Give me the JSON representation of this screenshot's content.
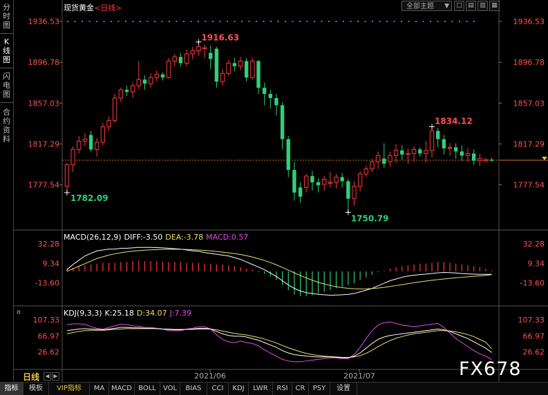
{
  "sidebar": {
    "tabs": [
      {
        "label": "分时图",
        "lines": [
          "分",
          "时",
          "图"
        ]
      },
      {
        "label": "K线图",
        "lines": [
          "K",
          "线",
          "图"
        ],
        "active": true
      },
      {
        "label": "闪电图",
        "lines": [
          "闪",
          "电",
          "图"
        ]
      },
      {
        "label": "合约资料",
        "lines": [
          "合",
          "约",
          "资",
          "料"
        ]
      }
    ]
  },
  "header": {
    "title": "现货黄金",
    "period": "<日线>",
    "theme_select": "全部主题",
    "theme_arrow": "▼",
    "tool_buttons": [
      "□",
      "▤",
      "▥"
    ]
  },
  "price_panel": {
    "right_axis_labels": [
      "1936.53",
      "1896.78",
      "1857.03",
      "1817.29",
      "1777.54"
    ],
    "left_axis_labels": [
      "1936.53",
      "1896.78",
      "1857.03",
      "1817.29",
      "1777.54"
    ],
    "annotations": {
      "high": "1916.63",
      "low": "1750.79",
      "left_low": "1782.09",
      "recent_high": "1834.12"
    },
    "current_price": 1801.5,
    "ylim": [
      1745,
      1944
    ]
  },
  "macd_panel": {
    "label": "MACD(26,12,9)",
    "diff": "DIFF:-3.50",
    "dea": "DEA:-3.78",
    "macd": "MACD:0.57",
    "axis_labels": [
      "32.28",
      "9.34",
      "-13.60"
    ]
  },
  "kdj_panel": {
    "label": "KDJ(9,3,3)",
    "k": "K:25.18",
    "d": "D:34.07",
    "j": "J:7.39",
    "axis_labels": [
      "107.33",
      "66.97",
      "26.62"
    ]
  },
  "x_axis": {
    "labels": [
      "2021/06",
      "2021/07"
    ]
  },
  "footer": {
    "period_label": "日线",
    "tabs": [
      "指标",
      "模板",
      "VIP指标",
      "MA",
      "MACD",
      "BOLL",
      "VOL",
      "BIAS",
      "CCI",
      "KDJ",
      "LWR",
      "RSI",
      "CR",
      "PSY",
      "设置"
    ]
  },
  "watermark": "FX678",
  "colors": {
    "up": "#ff3b3b",
    "down": "#2fd07a",
    "diff": "#ffffff",
    "dea": "#e9e26a",
    "j": "#e64ce6",
    "axis_red": "#ff5050"
  },
  "chart_data": {
    "type": "candlestick",
    "candles": [
      [
        1776,
        1797,
        1770,
        1799
      ],
      [
        1797,
        1812,
        1790,
        1815
      ],
      [
        1812,
        1820,
        1808,
        1825
      ],
      [
        1820,
        1822,
        1815,
        1828
      ],
      [
        1826,
        1812,
        1810,
        1830
      ],
      [
        1812,
        1819,
        1805,
        1823
      ],
      [
        1819,
        1834,
        1816,
        1838
      ],
      [
        1834,
        1840,
        1830,
        1844
      ],
      [
        1840,
        1862,
        1838,
        1866
      ],
      [
        1862,
        1870,
        1858,
        1872
      ],
      [
        1870,
        1868,
        1864,
        1874
      ],
      [
        1868,
        1874,
        1862,
        1877
      ],
      [
        1874,
        1880,
        1870,
        1898
      ],
      [
        1880,
        1876,
        1870,
        1884
      ],
      [
        1876,
        1882,
        1872,
        1886
      ],
      [
        1882,
        1885,
        1878,
        1889
      ],
      [
        1885,
        1882,
        1879,
        1887
      ],
      [
        1882,
        1898,
        1881,
        1901
      ],
      [
        1898,
        1902,
        1893,
        1905
      ],
      [
        1902,
        1896,
        1893,
        1906
      ],
      [
        1896,
        1905,
        1893,
        1909
      ],
      [
        1905,
        1908,
        1900,
        1912
      ],
      [
        1908,
        1912,
        1903,
        1916.63
      ],
      [
        1910,
        1911,
        1901,
        1914
      ],
      [
        1906,
        1900,
        1890,
        1913
      ],
      [
        1910,
        1878,
        1872,
        1912
      ],
      [
        1878,
        1886,
        1874,
        1890
      ],
      [
        1886,
        1896,
        1884,
        1899
      ],
      [
        1896,
        1893,
        1888,
        1901
      ],
      [
        1893,
        1898,
        1889,
        1902
      ],
      [
        1898,
        1882,
        1878,
        1901
      ],
      [
        1882,
        1898,
        1880,
        1901
      ],
      [
        1898,
        1872,
        1866,
        1899
      ],
      [
        1872,
        1866,
        1855,
        1877
      ],
      [
        1866,
        1862,
        1852,
        1870
      ],
      [
        1862,
        1855,
        1845,
        1866
      ],
      [
        1855,
        1822,
        1812,
        1858
      ],
      [
        1822,
        1792,
        1785,
        1825
      ],
      [
        1792,
        1770,
        1762,
        1800
      ],
      [
        1775,
        1766,
        1760,
        1780
      ],
      [
        1775,
        1786,
        1770,
        1788
      ],
      [
        1786,
        1780,
        1772,
        1791
      ],
      [
        1780,
        1777,
        1770,
        1784
      ],
      [
        1778,
        1783,
        1772,
        1786
      ],
      [
        1779,
        1780,
        1775,
        1790
      ],
      [
        1780,
        1785,
        1774,
        1788
      ],
      [
        1785,
        1781,
        1775,
        1789
      ],
      [
        1781,
        1764,
        1750.79,
        1783
      ],
      [
        1764,
        1776,
        1757,
        1781
      ],
      [
        1776,
        1788,
        1771,
        1791
      ],
      [
        1788,
        1793,
        1785,
        1796
      ],
      [
        1793,
        1800,
        1790,
        1803
      ],
      [
        1800,
        1806,
        1793,
        1810
      ],
      [
        1803,
        1798,
        1794,
        1818
      ],
      [
        1800,
        1806,
        1795,
        1810
      ],
      [
        1806,
        1811,
        1799,
        1817
      ],
      [
        1811,
        1807,
        1802,
        1816
      ],
      [
        1807,
        1808,
        1798,
        1813
      ],
      [
        1808,
        1812,
        1800,
        1815
      ],
      [
        1812,
        1808,
        1805,
        1814
      ],
      [
        1808,
        1811,
        1799,
        1820
      ],
      [
        1811,
        1830,
        1804,
        1834.12
      ],
      [
        1830,
        1822,
        1814,
        1833
      ],
      [
        1822,
        1813,
        1807,
        1826
      ],
      [
        1813,
        1814,
        1806,
        1818
      ],
      [
        1814,
        1810,
        1803,
        1818
      ],
      [
        1810,
        1806,
        1801,
        1816
      ],
      [
        1806,
        1808,
        1800,
        1813
      ],
      [
        1808,
        1801,
        1797,
        1812
      ],
      [
        1801,
        1803,
        1796,
        1808
      ],
      [
        1801,
        1802,
        1799,
        1804
      ],
      [
        1802,
        1801,
        1800,
        1804
      ]
    ],
    "macd_hist": [
      3,
      4,
      6,
      7,
      8,
      9,
      10,
      10,
      10,
      11,
      11,
      12,
      13,
      12,
      12,
      12,
      11,
      11,
      11,
      11,
      10,
      10,
      10,
      9,
      9,
      8,
      8,
      7,
      6,
      5,
      3,
      2,
      -1,
      -3,
      -6,
      -10,
      -16,
      -22,
      -27,
      -29,
      -29,
      -28,
      -26,
      -24,
      -22,
      -20,
      -18,
      -16,
      -14,
      -10,
      -7,
      -4,
      -1,
      1,
      3,
      5,
      6,
      7,
      8,
      9,
      9,
      10,
      11,
      11,
      10,
      9,
      8,
      7,
      6,
      5,
      3,
      1
    ],
    "diff": [
      2,
      8,
      13,
      18,
      21,
      24,
      25,
      26,
      26,
      27,
      27,
      27.5,
      28,
      28,
      28,
      27.8,
      27.5,
      27,
      26.5,
      26,
      25,
      24,
      23.5,
      22,
      21,
      20,
      19,
      18,
      16,
      14,
      11,
      8,
      5,
      2,
      -2,
      -6,
      -11,
      -16,
      -20,
      -23,
      -25,
      -26,
      -27,
      -27.5,
      -28,
      -27.8,
      -27.5,
      -27,
      -26,
      -24,
      -22,
      -20,
      -17,
      -14,
      -11,
      -9,
      -7,
      -5.5,
      -4.5,
      -3.8,
      -3.2,
      -2.5,
      -1.8,
      -1.3,
      -1.5,
      -2,
      -2.6,
      -3,
      -3.3,
      -3.5,
      -3.5,
      -3.5
    ],
    "dea": [
      0,
      3,
      6,
      9,
      12,
      15,
      17,
      19,
      20.5,
      21.8,
      22.8,
      23.6,
      24.3,
      24.8,
      25.2,
      25.5,
      25.7,
      25.8,
      25.8,
      25.8,
      25.6,
      25.3,
      25,
      24.5,
      24,
      23.3,
      22.5,
      21.7,
      20.8,
      19.7,
      18.3,
      16.7,
      14.8,
      12.7,
      10.3,
      7.6,
      4.6,
      1.4,
      -1.8,
      -4.9,
      -7.8,
      -10.4,
      -12.8,
      -14.8,
      -16.6,
      -18,
      -19.1,
      -19.9,
      -20.4,
      -20.6,
      -20.5,
      -20.2,
      -19.6,
      -18.8,
      -17.8,
      -16.7,
      -15.6,
      -14.4,
      -13.3,
      -12.3,
      -11.4,
      -10.5,
      -9.7,
      -9,
      -8.3,
      -7.6,
      -7,
      -6.4,
      -5.8,
      -5.3,
      -4.8,
      -3.8
    ],
    "kdj_k": [
      80,
      82,
      84,
      85,
      84,
      83,
      82,
      84,
      86,
      88,
      88,
      87,
      87,
      86,
      86,
      85,
      84,
      83,
      82,
      82,
      83,
      84,
      86,
      86,
      84,
      78,
      72,
      68,
      66,
      66,
      64,
      60,
      56,
      50,
      44,
      38,
      30,
      24,
      20,
      18,
      16,
      15,
      14,
      14,
      14,
      13,
      12,
      12,
      16,
      24,
      36,
      48,
      58,
      64,
      68,
      70,
      72,
      74,
      76,
      78,
      80,
      82,
      84,
      82,
      78,
      72,
      66,
      60,
      52,
      44,
      36,
      25.18
    ],
    "kdj_d": [
      72,
      75,
      78,
      80,
      81,
      81,
      81,
      82,
      83,
      84,
      85,
      85,
      85,
      85,
      85,
      85,
      84,
      84,
      83,
      83,
      83,
      83,
      84,
      84,
      84,
      82,
      79,
      76,
      73,
      71,
      69,
      66,
      63,
      59,
      54,
      49,
      43,
      37,
      32,
      27,
      23,
      20,
      18,
      16,
      15,
      14,
      13,
      13,
      14,
      17,
      23,
      31,
      40,
      48,
      55,
      61,
      65,
      69,
      72,
      74,
      76,
      78,
      80,
      80,
      79,
      77,
      74,
      70,
      65,
      58,
      51,
      34.07
    ],
    "kdj_j": [
      95,
      97,
      97,
      96,
      90,
      86,
      84,
      88,
      92,
      96,
      95,
      92,
      91,
      88,
      88,
      86,
      84,
      80,
      80,
      80,
      84,
      86,
      90,
      90,
      84,
      70,
      58,
      52,
      50,
      54,
      50,
      48,
      42,
      32,
      24,
      16,
      8,
      4,
      2,
      2,
      4,
      6,
      8,
      10,
      12,
      12,
      10,
      10,
      20,
      38,
      60,
      80,
      94,
      100,
      102,
      98,
      94,
      92,
      90,
      92,
      94,
      96,
      98,
      88,
      74,
      60,
      50,
      40,
      30,
      22,
      16,
      7.39
    ]
  }
}
